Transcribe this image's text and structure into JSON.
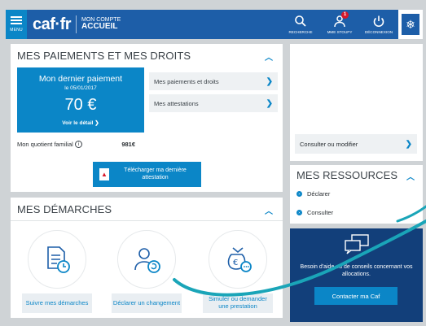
{
  "header": {
    "menu_label": "MENU",
    "logo": "caf·fr",
    "account_line1": "MON COMPTE",
    "account_line2": "ACCUEIL",
    "actions": [
      {
        "label": "RECHERCHE",
        "icon": "search-icon"
      },
      {
        "label": "MME STOUPY",
        "icon": "user-icon",
        "badge": "1"
      },
      {
        "label": "DÉCONNEXION",
        "icon": "power-icon"
      }
    ]
  },
  "paiements": {
    "title": "MES PAIEMENTS ET MES DROITS",
    "last_payment_title": "Mon dernier paiement",
    "last_payment_date": "le 05/01/2017",
    "last_payment_amount": "70 €",
    "last_payment_link": "Voir le détail ❯",
    "links": [
      "Mes paiements et droits",
      "Mes attestations"
    ],
    "qf_label": "Mon quotient familial",
    "qf_info": "i",
    "qf_value": "981€",
    "download_label": "Télécharger ma dernière attestation"
  },
  "demarches": {
    "title": "MES DÉMARCHES",
    "items": [
      {
        "label": "Suivre mes démarches",
        "icon": "document-clock-icon"
      },
      {
        "label": "Déclarer un changement",
        "icon": "user-change-icon"
      },
      {
        "label": "Simuler ou demander une prestation",
        "icon": "money-bag-icon"
      }
    ]
  },
  "right": {
    "consult_label": "Consulter ou modifier",
    "ressources_title": "MES RESSOURCES",
    "ressources_items": [
      "Déclarer",
      "Consulter"
    ],
    "aide_text": "Besoin d'aide ou de conseils concernant vos allocations.",
    "aide_button": "Contacter ma Caf"
  },
  "colors": {
    "brand_blue": "#1d5ea8",
    "accent_blue": "#0b86c7",
    "dark_blue": "#123f7a",
    "swoosh_teal": "#1aa5b8"
  }
}
